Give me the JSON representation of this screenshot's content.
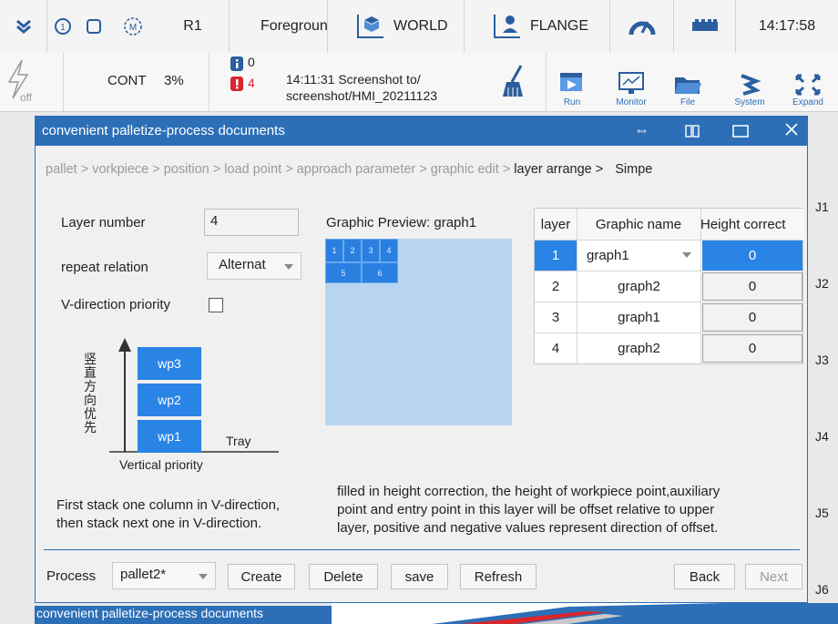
{
  "topbar": {
    "robot": "R1",
    "mode": "Foreground",
    "coord": "WORLD",
    "tool": "FLANGE",
    "time": "14:17:58"
  },
  "secondbar": {
    "power_label": "off",
    "run_mode": "CONT",
    "speed": "3%",
    "info_count": "0",
    "error_count": "4",
    "message_line1": "14:11:31 Screenshot to/",
    "message_line2": "screenshot/HMI_20211123",
    "tools": [
      {
        "label": "Run"
      },
      {
        "label": "Monitor"
      },
      {
        "label": "File"
      },
      {
        "label": "System"
      },
      {
        "label": "Expand"
      }
    ]
  },
  "joints": [
    "J1",
    "J2",
    "J3",
    "J4",
    "J5",
    "J6"
  ],
  "dialog": {
    "title": "convenient palletize-process documents",
    "breadcrumb": {
      "before": "pallet > vorkpiece > position > load point > approach parameter > graphic edit > ",
      "current": "layer arrange >",
      "after": "Simpe"
    },
    "layer_number_label": "Layer number",
    "layer_number_value": "4",
    "repeat_relation_label": "repeat relation",
    "repeat_relation_value": "Alternat",
    "v_priority_label": "V-direction priority",
    "preview_label": "Graphic Preview: graph1",
    "preview_cells": [
      "1",
      "2",
      "3",
      "4",
      "5",
      "6"
    ],
    "illustration": {
      "vertical_text": [
        "竖",
        "直",
        "方",
        "向",
        "优",
        "先"
      ],
      "workpieces": [
        "wp3",
        "wp2",
        "wp1"
      ],
      "tray": "Tray",
      "caption": "Vertical priority"
    },
    "left_desc": [
      "First stack one column in V-direction,",
      "then stack next one in V-direction."
    ],
    "right_desc": [
      "filled in height correction, the height of workpiece point,auxiliary",
      "point and entry point in this layer will be offset relative to upper",
      "layer, positive and negative values represent direction of offset."
    ],
    "table": {
      "headers": [
        "layer",
        "Graphic name",
        "Height correct"
      ],
      "rows": [
        {
          "layer": "1",
          "graphic": "graph1",
          "height": "0"
        },
        {
          "layer": "2",
          "graphic": "graph2",
          "height": "0"
        },
        {
          "layer": "3",
          "graphic": "graph1",
          "height": "0"
        },
        {
          "layer": "4",
          "graphic": "graph2",
          "height": "0"
        }
      ]
    },
    "bottom": {
      "process_label": "Process",
      "process_value": "pallet2*",
      "create": "Create",
      "delete": "Delete",
      "save": "save",
      "refresh": "Refresh",
      "back": "Back",
      "next": "Next"
    }
  },
  "taskbar": {
    "item": "convenient palletize-process documents"
  }
}
